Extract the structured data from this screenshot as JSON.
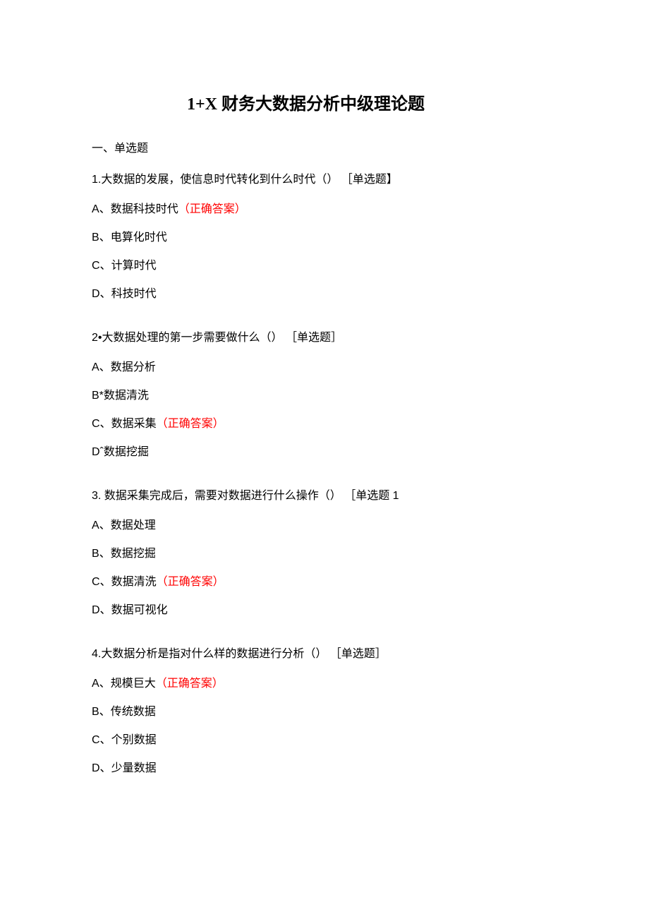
{
  "title": "1+X 财务大数据分析中级理论题",
  "section_heading": "一、单选题",
  "correct_label": "（正确答案）",
  "questions": [
    {
      "stem": "1.大数据的发展，使信息时代转化到什么时代（） ［单选题】",
      "options": [
        {
          "prefix": "A、",
          "text": "数据科技时代",
          "correct": true
        },
        {
          "prefix": "B、",
          "text": "电算化时代",
          "correct": false
        },
        {
          "prefix": "C、",
          "text": "计算时代",
          "correct": false
        },
        {
          "prefix": "D、",
          "text": "科技时代",
          "correct": false
        }
      ]
    },
    {
      "stem": "2•大数据处理的第一步需要做什么（） ［单选题］",
      "options": [
        {
          "prefix": "A、",
          "text": "数据分析",
          "correct": false
        },
        {
          "prefix": "B*",
          "text": "数据清洗",
          "correct": false
        },
        {
          "prefix": "C、",
          "text": "数据采集",
          "correct": true
        },
        {
          "prefix": "Dˆ",
          "text": "数据挖掘",
          "correct": false
        }
      ]
    },
    {
      "stem": "3. 数据采集完成后，需要对数据进行什么操作（） ［单选题 1",
      "options": [
        {
          "prefix": "A、",
          "text": "数据处理",
          "correct": false
        },
        {
          "prefix": "B、",
          "text": "数据挖掘",
          "correct": false
        },
        {
          "prefix": "C、",
          "text": "数据清洗",
          "correct": true
        },
        {
          "prefix": "D、",
          "text": "数据可视化",
          "correct": false
        }
      ]
    },
    {
      "stem": "4.大数据分析是指对什么样的数据进行分析（） ［单选题］",
      "options": [
        {
          "prefix": "A、",
          "text": "规模巨大",
          "correct": true
        },
        {
          "prefix": "B、",
          "text": "传统数据",
          "correct": false
        },
        {
          "prefix": "C、",
          "text": "个别数据",
          "correct": false
        },
        {
          "prefix": "D、",
          "text": "少量数据",
          "correct": false
        }
      ]
    }
  ]
}
